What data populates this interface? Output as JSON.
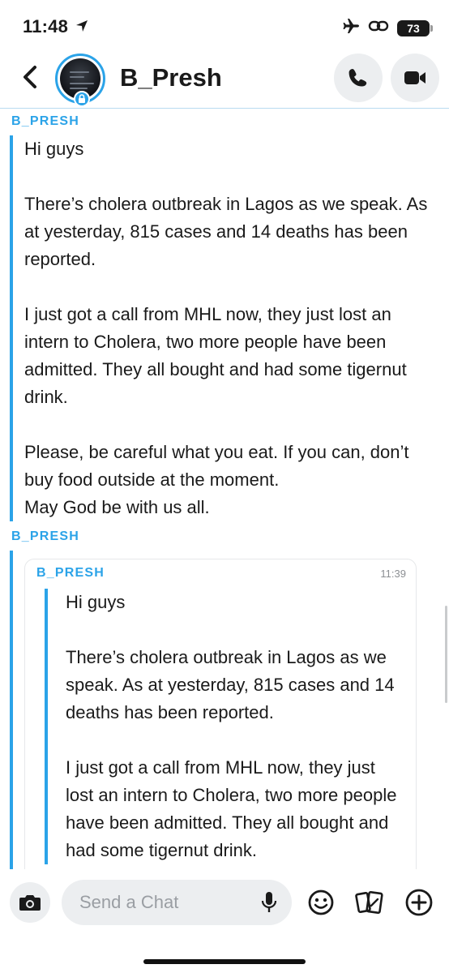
{
  "status_bar": {
    "time": "11:48",
    "battery": "73",
    "icons": [
      "location-arrow-icon",
      "airplane-icon",
      "link-icon",
      "battery-icon"
    ]
  },
  "header": {
    "contact_name": "B_Presh",
    "icons": [
      "back-chevron-icon",
      "lock-icon",
      "phone-icon",
      "video-camera-icon"
    ]
  },
  "messages": [
    {
      "sender": "B_PRESH",
      "text": "Hi guys\n\nThere’s cholera outbreak in Lagos as we speak. As at yesterday, 815 cases and 14 deaths has been reported.\n\nI just got a call from MHL now, they just lost an intern to Cholera, two more people have been admitted. They all bought and had some tigernut drink.\n\nPlease, be careful what you eat. If you can, don’t buy food outside at the moment.\nMay God be with us all."
    },
    {
      "sender": "B_PRESH",
      "quoted": {
        "sender": "B_PRESH",
        "time": "11:39",
        "text": "Hi guys\n\nThere’s cholera outbreak in Lagos as we speak. As at yesterday, 815 cases and 14 deaths has been reported.\n\nI just got a call from MHL now, they just lost an intern to Cholera, two more people have been admitted. They all bought and had some tigernut drink."
      }
    }
  ],
  "composer": {
    "placeholder": "Send a Chat",
    "icons": [
      "camera-icon",
      "microphone-icon",
      "emoji-icon",
      "sticker-icon",
      "plus-icon"
    ]
  },
  "colors": {
    "accent": "#2ba3e8",
    "button_bg": "#eceef0",
    "text": "#1a1a1a"
  }
}
